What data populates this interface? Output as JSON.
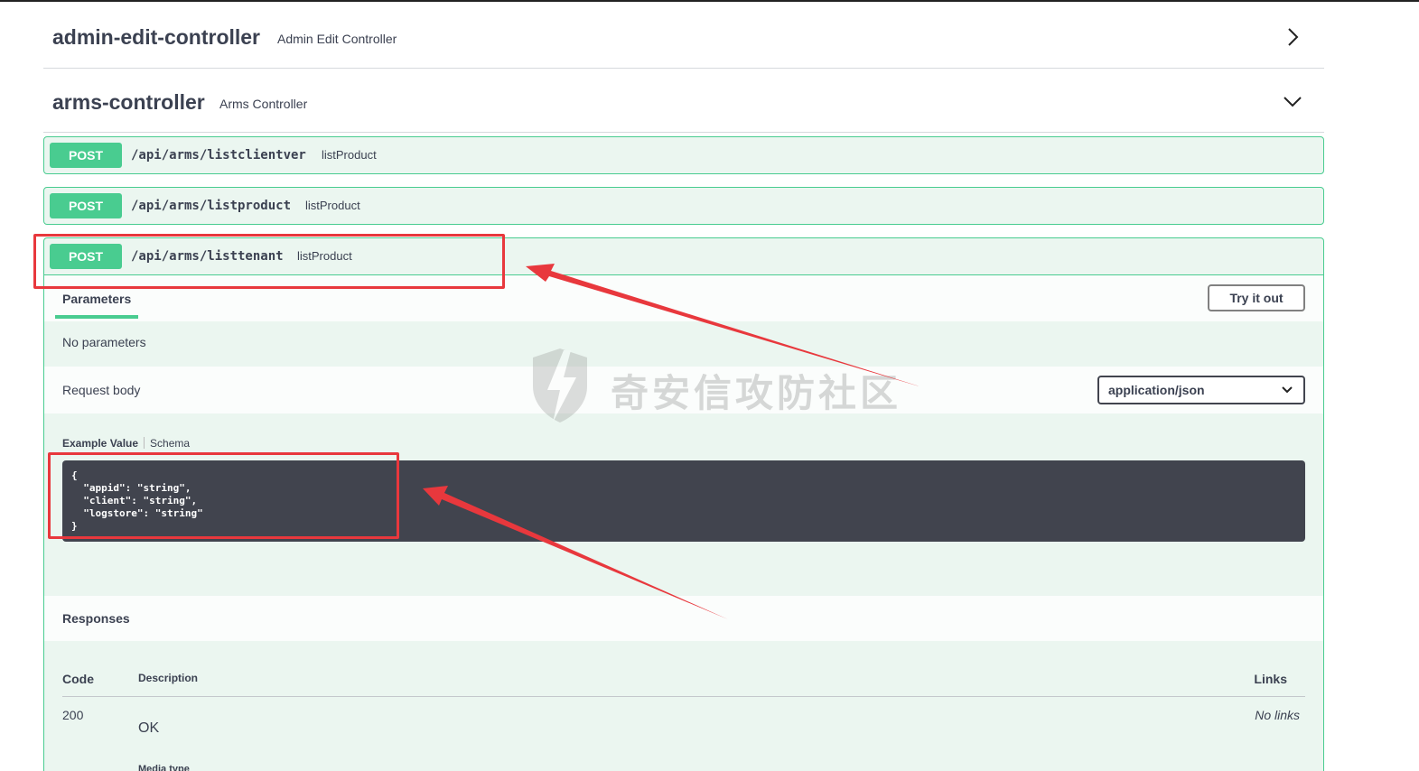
{
  "tags": [
    {
      "name": "admin-edit-controller",
      "description": "Admin Edit Controller",
      "state": "collapsed"
    },
    {
      "name": "arms-controller",
      "description": "Arms Controller",
      "state": "expanded"
    }
  ],
  "operations": [
    {
      "method": "POST",
      "path": "/api/arms/listclientver",
      "summary": "listProduct"
    },
    {
      "method": "POST",
      "path": "/api/arms/listproduct",
      "summary": "listProduct"
    },
    {
      "method": "POST",
      "path": "/api/arms/listtenant",
      "summary": "listProduct"
    }
  ],
  "expanded_op": {
    "parameters_tab": "Parameters",
    "try_button": "Try it out",
    "no_parameters": "No parameters",
    "request_body_label": "Request body",
    "content_type": "application/json",
    "example_tab": "Example Value",
    "schema_tab": "Schema",
    "example_json": "{\n  \"appid\": \"string\",\n  \"client\": \"string\",\n  \"logstore\": \"string\"\n}",
    "responses_title": "Responses",
    "columns": {
      "code": "Code",
      "description": "Description",
      "links": "Links"
    },
    "responses": [
      {
        "code": "200",
        "description": "OK",
        "links": "No links"
      }
    ],
    "media_type_partial": "Media type"
  },
  "watermark": "奇安信攻防社区",
  "colors": {
    "post": "#49cc90",
    "post_bg": "#ebf6f0",
    "annotation": "#e8383d",
    "code_bg": "#41444e"
  }
}
